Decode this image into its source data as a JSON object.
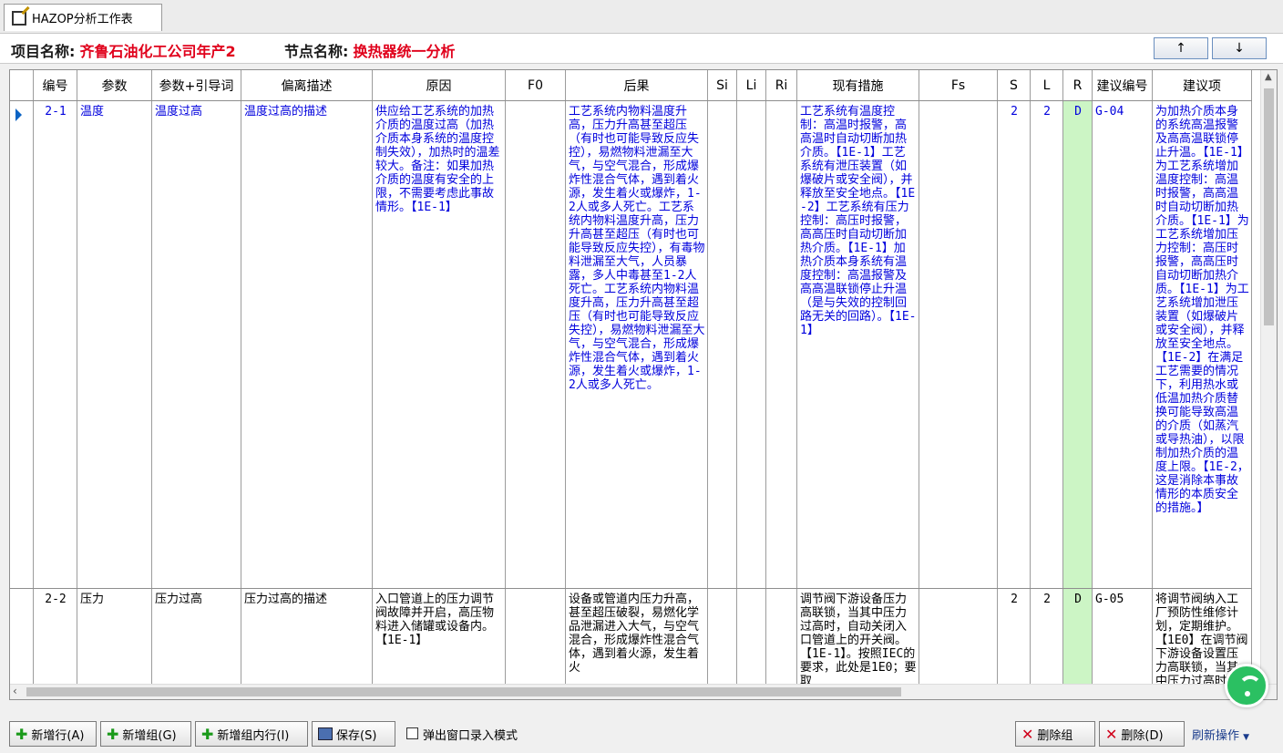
{
  "tab": {
    "title": "HAZOP分析工作表"
  },
  "info": {
    "project_label": "项目名称:",
    "project_value": "齐鲁石油化工公司年产2",
    "node_label": "节点名称:",
    "node_value": "换热器统一分析"
  },
  "nav": {
    "up_label": "↑",
    "down_label": "↓"
  },
  "columns": [
    "编号",
    "参数",
    "参数+引导词",
    "偏离描述",
    "原因",
    "F0",
    "后果",
    "Si",
    "Li",
    "Ri",
    "现有措施",
    "Fs",
    "S",
    "L",
    "R",
    "建议编号",
    "建议项"
  ],
  "rows": [
    {
      "id": "2-1",
      "param": "温度",
      "param_guide": "温度过高",
      "deviation": "温度过高的描述",
      "cause": "供应给工艺系统的加热介质的温度过高（加热介质本身系统的温度控制失效），加热时的温差较大。备注：如果加热介质的温度有安全的上限，不需要考虑此事故情形。【1E-1】",
      "f0": "",
      "consequence": "工艺系统内物料温度升高，压力升高甚至超压（有时也可能导致反应失控），易燃物料泄漏至大气，与空气混合，形成爆炸性混合气体，遇到着火源，发生着火或爆炸，1-2人或多人死亡。工艺系统内物料温度升高，压力升高甚至超压（有时也可能导致反应失控），有毒物料泄漏至大气，人员暴露，多人中毒甚至1-2人死亡。工艺系统内物料温度升高，压力升高甚至超压（有时也可能导致反应失控），易燃物料泄漏至大气，与空气混合，形成爆炸性混合气体，遇到着火源，发生着火或爆炸，1-2人或多人死亡。",
      "si": "",
      "li": "",
      "ri": "",
      "measures": "工艺系统有温度控制：高温时报警，高高温时自动切断加热介质。【1E-1】工艺系统有泄压装置（如爆破片或安全阀），并释放至安全地点。【1E-2】工艺系统有压力控制：高压时报警，高高压时自动切断加热介质。【1E-1】加热介质本身系统有温度控制：高温报警及高高温联锁停止升温（是与失效的控制回路无关的回路）。【1E-1】",
      "fs": "",
      "s": "2",
      "l": "2",
      "r": "D",
      "sug_no": "G-04",
      "suggestion": "为加热介质本身的系统高温报警及高高温联锁停止升温。【1E-1】为工艺系统增加温度控制：高温时报警，高高温时自动切断加热介质。【1E-1】为工艺系统增加压力控制：高压时报警，高高压时自动切断加热介质。【1E-1】为工艺系统增加泄压装置（如爆破片或安全阀），并释放至安全地点。【1E-2】在满足工艺需要的情况下，利用热水或低温加热介质替换可能导致高温的介质（如蒸汽或导热油），以限制加热介质的温度上限。【1E-2，这是消除本事故情形的本质安全的措施。】"
    },
    {
      "id": "2-2",
      "param": "压力",
      "param_guide": "压力过高",
      "deviation": "压力过高的描述",
      "cause": "入口管道上的压力调节阀故障并开启，高压物料进入储罐或设备内。【1E-1】",
      "f0": "",
      "consequence": "设备或管道内压力升高，甚至超压破裂，易燃化学品泄漏进入大气，与空气混合，形成爆炸性混合气体，遇到着火源，发生着火",
      "si": "",
      "li": "",
      "ri": "",
      "measures": "调节阀下游设备压力高联锁，当其中压力过高时，自动关闭入口管道上的开关阀。【1E-1】。按照IEC的要求，此处是1E0；要取",
      "fs": "",
      "s": "2",
      "l": "2",
      "r": "D",
      "sug_no": "G-05",
      "suggestion": "将调节阀纳入工厂预防性维修计划，定期维护。【1E0】在调节阀下游设备设置压力高联锁，当其中压力过高时，自动关"
    }
  ],
  "toolbar": {
    "add_row": "新增行(A)",
    "add_group": "新增组(G)",
    "add_group_row": "新增组内行(I)",
    "save": "保存(S)",
    "popup_mode": "弹出窗口录入模式",
    "delete_group": "删除组",
    "delete": "删除(D)",
    "refresh": "刷新操作"
  }
}
